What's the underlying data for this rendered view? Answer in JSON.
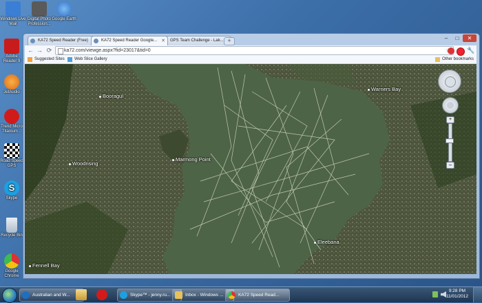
{
  "desktop": {
    "icons": [
      {
        "label": "Windows Live Mail",
        "color": "#3a7fd5"
      },
      {
        "label": "Digital Photo Profession...",
        "color": "#5a5a5a"
      },
      {
        "label": "Google Earth",
        "color": "#2c6fc9"
      },
      {
        "label": "Adobe Reader 9",
        "color": "#c81c1c"
      },
      {
        "label": "JetAudio",
        "color": "#e06a10"
      },
      {
        "label": "Trend Micro Titanium...",
        "color": "#d11b1b"
      },
      {
        "label": "Road Speed GPS",
        "color": "#222222"
      },
      {
        "label": "Skype",
        "color": "#1ba0e2"
      },
      {
        "label": "Recycle Bin",
        "color": "#c6d3e0"
      },
      {
        "label": "Google Chrome",
        "color": "#3b8b3b"
      }
    ]
  },
  "browser": {
    "tabs": [
      {
        "label": "KA72 Speed Reader (Free)"
      },
      {
        "label": "KA72 Speed Reader Google..."
      },
      {
        "label": "GPS Team Challenge - Lak..."
      }
    ],
    "new_tab_label": "+",
    "url": "ka72.com/viewge.aspx?fid=23017&tid=0",
    "bookmarks": {
      "suggested": "Suggested Sites",
      "gallery": "Web Slice Gallery",
      "other": "Other bookmarks"
    },
    "window_controls": {
      "min": "–",
      "max": "□",
      "close": "✕"
    },
    "nav": {
      "back": "←",
      "forward": "→",
      "reload": "⟳"
    }
  },
  "map": {
    "places": [
      {
        "name": "Booragul"
      },
      {
        "name": "Warners Bay"
      },
      {
        "name": "Woodrising"
      },
      {
        "name": "Marmong Point"
      },
      {
        "name": "Eleebana"
      },
      {
        "name": "Fennell Bay"
      }
    ],
    "colors": {
      "water": "#4e6446",
      "land": "#3d4a2c"
    }
  },
  "taskbar": {
    "buttons": [
      {
        "label": "Australian and W...",
        "color": "#1e6fc1",
        "active": false
      },
      {
        "label": "Skype™ - jenny.ru...",
        "color": "#1ba0e2",
        "active": false
      },
      {
        "label": "Inbox - Windows ...",
        "color": "#e8c15a",
        "active": false
      },
      {
        "label": "KA72 Speed Read...",
        "color": "#3b8b3b",
        "active": true
      }
    ],
    "clock": {
      "time": "9:28 PM",
      "date": "11/01/2012"
    }
  }
}
